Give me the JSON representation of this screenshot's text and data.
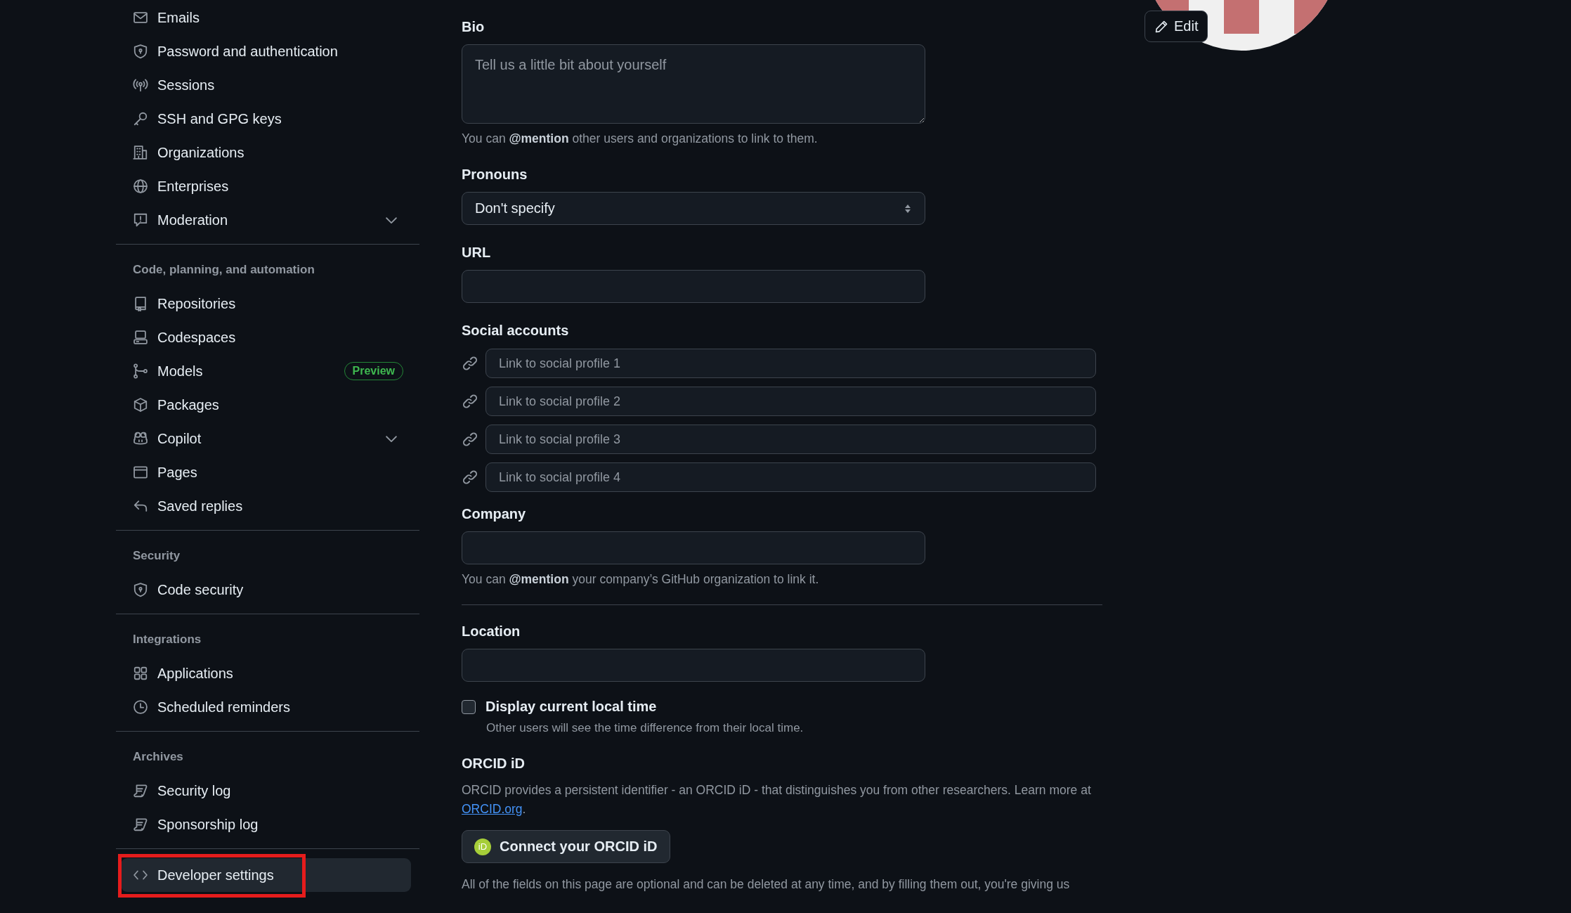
{
  "sidebar": {
    "groups": [
      {
        "items": [
          {
            "label": "Emails",
            "kind": "link",
            "selected": false,
            "annotated": false
          },
          {
            "label": "Password and authentication",
            "kind": "link",
            "selected": false,
            "annotated": false
          },
          {
            "label": "Sessions",
            "kind": "link",
            "selected": false,
            "annotated": false
          },
          {
            "label": "SSH and GPG keys",
            "kind": "link",
            "selected": false,
            "annotated": false
          },
          {
            "label": "Organizations",
            "kind": "link",
            "selected": false,
            "annotated": false
          },
          {
            "label": "Enterprises",
            "kind": "link",
            "selected": false,
            "annotated": false
          },
          {
            "label": "Moderation",
            "kind": "group",
            "expanded": false,
            "selected": false,
            "annotated": false
          }
        ]
      },
      {
        "heading": "Code, planning, and automation",
        "items": [
          {
            "label": "Repositories",
            "kind": "link",
            "selected": false,
            "annotated": false
          },
          {
            "label": "Codespaces",
            "kind": "link",
            "selected": false,
            "annotated": false
          },
          {
            "label": "Models",
            "kind": "link",
            "badge": "Preview",
            "selected": false,
            "annotated": false
          },
          {
            "label": "Packages",
            "kind": "link",
            "selected": false,
            "annotated": false
          },
          {
            "label": "Copilot",
            "kind": "group",
            "expanded": false,
            "selected": false,
            "annotated": false
          },
          {
            "label": "Pages",
            "kind": "link",
            "selected": false,
            "annotated": false
          },
          {
            "label": "Saved replies",
            "kind": "link",
            "selected": false,
            "annotated": false
          }
        ]
      },
      {
        "heading": "Security",
        "items": [
          {
            "label": "Code security",
            "kind": "link",
            "selected": false,
            "annotated": false
          }
        ]
      },
      {
        "heading": "Integrations",
        "items": [
          {
            "label": "Applications",
            "kind": "link",
            "selected": false,
            "annotated": false
          },
          {
            "label": "Scheduled reminders",
            "kind": "link",
            "selected": false,
            "annotated": false
          }
        ]
      },
      {
        "heading": "Archives",
        "items": [
          {
            "label": "Security log",
            "kind": "link",
            "selected": false,
            "annotated": false
          },
          {
            "label": "Sponsorship log",
            "kind": "link",
            "selected": false,
            "annotated": false
          }
        ]
      },
      {
        "items": [
          {
            "label": "Developer settings",
            "kind": "link",
            "selected": true,
            "annotated": true
          }
        ]
      }
    ]
  },
  "profile_form": {
    "bio": {
      "label": "Bio",
      "placeholder": "Tell us a little bit about yourself",
      "note": "You can **@mention** other users and organizations to link to them."
    },
    "pronouns": {
      "label": "Pronouns",
      "value": "Don't specify"
    },
    "url": {
      "label": "URL"
    },
    "social_accounts": {
      "label": "Social accounts",
      "fields": [
        {
          "placeholder": "Link to social profile 1"
        },
        {
          "placeholder": "Link to social profile 2"
        },
        {
          "placeholder": "Link to social profile 3"
        },
        {
          "placeholder": "Link to social profile 4"
        }
      ]
    },
    "company": {
      "label": "Company",
      "note": "You can **@mention** your company’s GitHub organization to link it."
    },
    "location": {
      "label": "Location"
    },
    "local_time": {
      "label": "Display current local time",
      "checked": false,
      "note": "Other users will see the time difference from their local time."
    },
    "orcid": {
      "heading": "ORCID iD",
      "description": "ORCID provides a persistent identifier - an ORCID iD - that distinguishes you from other researchers. Learn more at",
      "link": "ORCID.org",
      "description_end": ".",
      "button": "Connect your ORCID iD",
      "button_icon_text": "iD"
    },
    "footer_note": "All of the fields on this page are optional and can be deleted at any time, and by filling them out, you're giving us"
  },
  "avatar": {
    "edit_button": "Edit"
  }
}
